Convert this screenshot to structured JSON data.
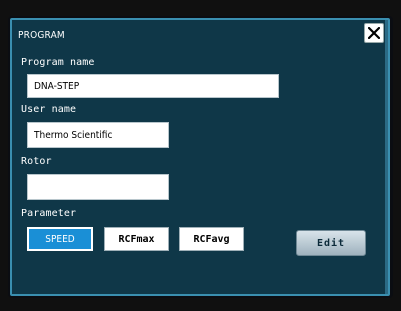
{
  "dialog": {
    "title": "PROGRAM"
  },
  "program_name": {
    "label": "Program name",
    "value": "DNA-STEP"
  },
  "user_name": {
    "label": "User name",
    "value": "Thermo Scientific"
  },
  "rotor": {
    "label": "Rotor",
    "value": ""
  },
  "parameter": {
    "label": "Parameter",
    "options": [
      "SPEED",
      "RCFmax",
      "RCFavg"
    ],
    "selected": "SPEED"
  },
  "edit": {
    "label": "Edit"
  }
}
